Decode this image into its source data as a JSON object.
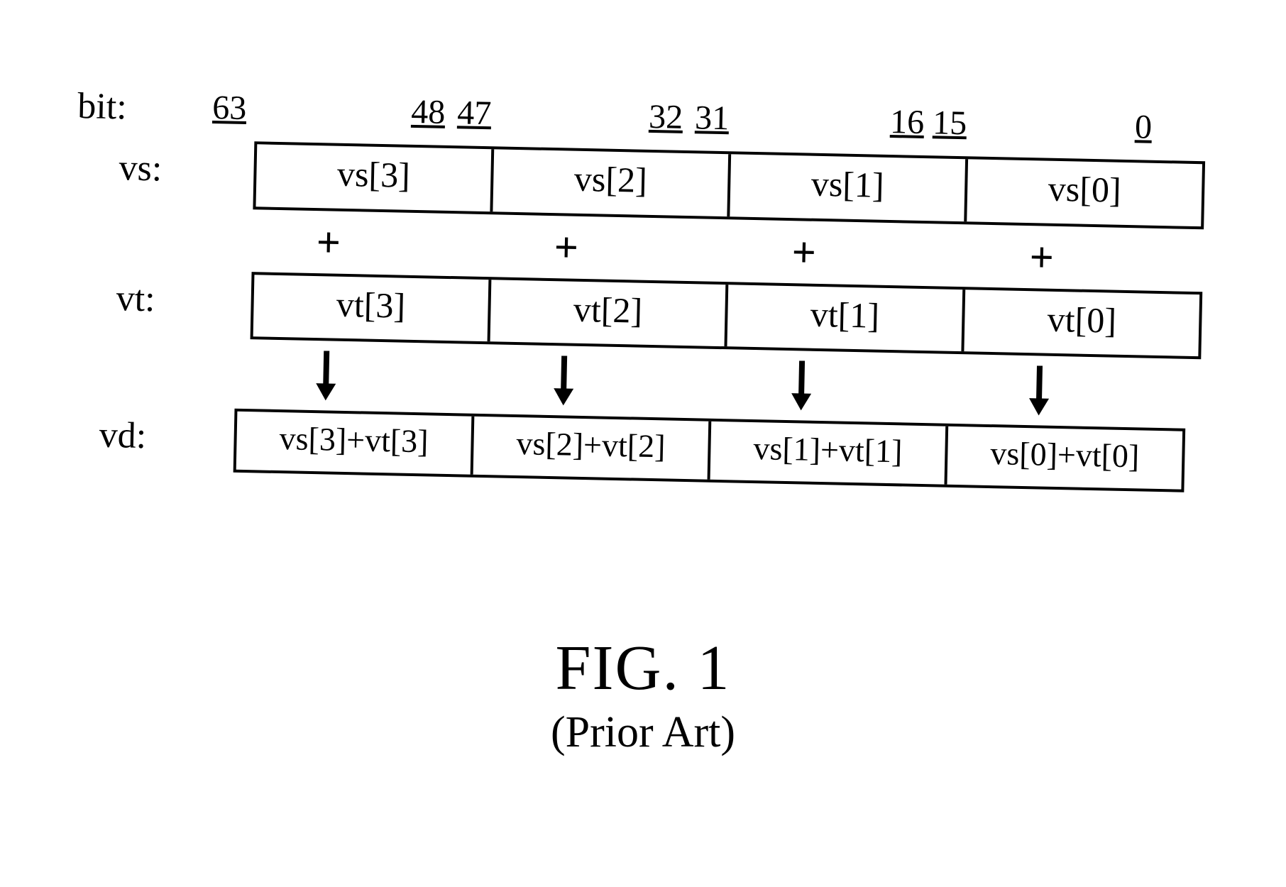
{
  "bit": {
    "label": "bit:",
    "positions": {
      "p63": "63",
      "p48": "48",
      "p47": "47",
      "p32": "32",
      "p31": "31",
      "p16": "16",
      "p15": "15",
      "p0": "0"
    }
  },
  "vs": {
    "label": "vs:",
    "cells": [
      "vs[3]",
      "vs[2]",
      "vs[1]",
      "vs[0]"
    ]
  },
  "plus": "+",
  "vt": {
    "label": "vt:",
    "cells": [
      "vt[3]",
      "vt[2]",
      "vt[1]",
      "vt[0]"
    ]
  },
  "vd": {
    "label": "vd:",
    "cells": [
      "vs[3]+vt[3]",
      "vs[2]+vt[2]",
      "vs[1]+vt[1]",
      "vs[0]+vt[0]"
    ]
  },
  "caption": {
    "fig": "FIG. 1",
    "sub": "(Prior Art)"
  }
}
